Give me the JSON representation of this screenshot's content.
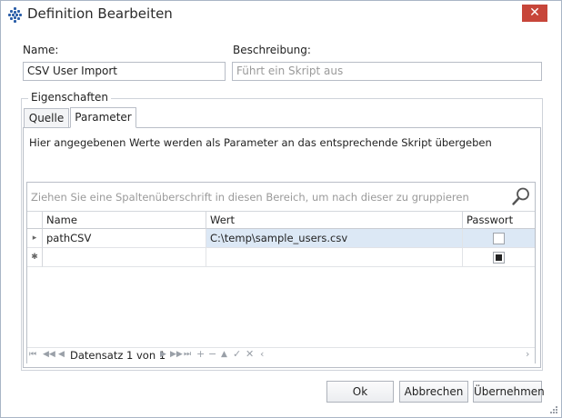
{
  "window": {
    "title": "Definition Bearbeiten",
    "close_glyph": "✕"
  },
  "form": {
    "name_label": "Name:",
    "name_value": "CSV User Import",
    "desc_label": "Beschreibung:",
    "desc_placeholder": "Führt ein Skript aus"
  },
  "group": {
    "legend": "Eigenschaften"
  },
  "tabs": [
    {
      "label": "Quelle",
      "active": false
    },
    {
      "label": "Parameter",
      "active": true
    }
  ],
  "parameter_tab": {
    "description": "Hier angegebenen Werte werden als Parameter an das entsprechende Skript übergeben"
  },
  "grid": {
    "group_panel_text": "Ziehen Sie eine Spaltenüberschrift in diesen Bereich, um nach dieser zu gruppieren",
    "columns": [
      "Name",
      "Wert",
      "Passwort"
    ],
    "rows": [
      {
        "indicator": "▸",
        "name": "pathCSV",
        "wert": "C:\\temp\\sample_users.csv",
        "passwort": false
      }
    ],
    "new_row": {
      "indicator": "✱",
      "name": "",
      "wert": "",
      "passwort": "indeterminate"
    },
    "navigator": {
      "record_text": "Datensatz 1 von 1"
    }
  },
  "buttons": {
    "ok": "Ok",
    "cancel": "Abbrechen",
    "apply": "Übernehmen"
  },
  "icons": [
    "app-grid-icon",
    "close-icon",
    "search-icon",
    "row-indicator-icon",
    "new-row-icon",
    "resize-grip-icon"
  ]
}
